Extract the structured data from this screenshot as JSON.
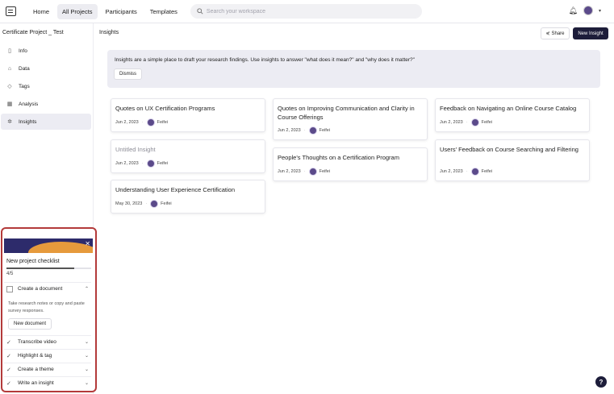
{
  "nav": {
    "items": [
      "Home",
      "All Projects",
      "Participants",
      "Templates"
    ],
    "search_placeholder": "Search your workspace"
  },
  "sidebar": {
    "project_title": "Certificate Project _ Test",
    "items": [
      {
        "label": "Info",
        "icon": "document-icon"
      },
      {
        "label": "Data",
        "icon": "data-icon"
      },
      {
        "label": "Tags",
        "icon": "tag-icon"
      },
      {
        "label": "Analysis",
        "icon": "analysis-icon"
      },
      {
        "label": "Insights",
        "icon": "insights-icon"
      }
    ]
  },
  "checklist": {
    "title": "New project checklist",
    "progress": "4/5",
    "progress_fraction": 0.8,
    "items": [
      {
        "label": "Create a document",
        "done": false,
        "expanded": true
      },
      {
        "label": "Transcribe video",
        "done": true
      },
      {
        "label": "Highlight & tag",
        "done": true
      },
      {
        "label": "Create a theme",
        "done": true
      },
      {
        "label": "Write an insight",
        "done": true
      }
    ],
    "expanded_desc": "Take research notes or copy and paste survey responses.",
    "expanded_button": "New document"
  },
  "main": {
    "title": "Insights",
    "share_label": "Share",
    "new_insight_label": "New Insight",
    "banner_text": "Insights are a simple place to draft your research findings. Use insights to answer \"what does it mean?\" and \"why does it matter?\"",
    "dismiss_label": "Dismiss"
  },
  "cards": [
    {
      "title": "Quotes on UX Certification Programs",
      "date": "Jun 2, 2023",
      "author": "Feifei"
    },
    {
      "title": "Untitled Insight",
      "date": "Jun 2, 2023",
      "author": "Feifei",
      "muted": true
    },
    {
      "title": "Understanding User Experience Certification",
      "date": "May 30, 2023",
      "author": "Feifei"
    },
    {
      "title": "Quotes on Improving Communication and Clarity in Course Offerings",
      "date": "Jun 2, 2023",
      "author": "Feifei"
    },
    {
      "title": "People's Thoughts on a Certification Program",
      "date": "Jun 2, 2023",
      "author": "Feifei"
    },
    {
      "title": "Feedback on Navigating an Online Course Catalog",
      "date": "Jun 2, 2023",
      "author": "Feifei"
    },
    {
      "title": "Users' Feedback on Course Searching and Filtering",
      "date": "Jun 2, 2023",
      "author": "Feifei"
    }
  ],
  "help_label": "?"
}
